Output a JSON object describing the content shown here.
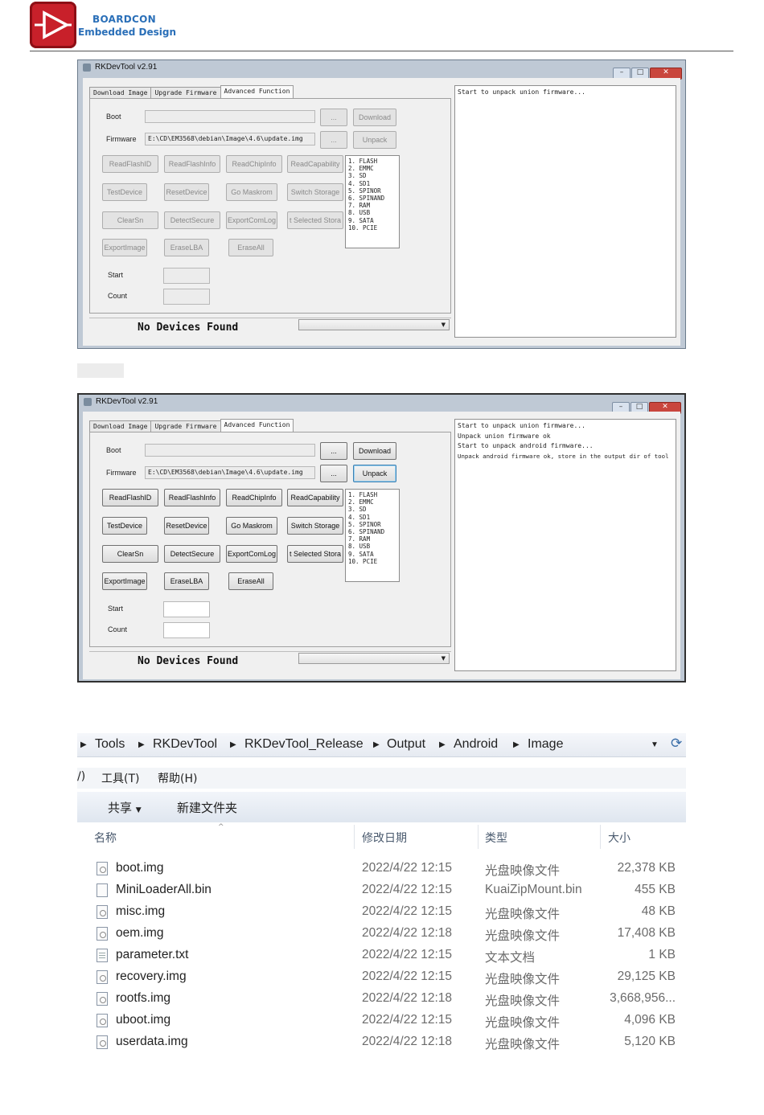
{
  "header": {
    "brand_line1": "BOARDCON",
    "brand_line2": "Embedded Design"
  },
  "tool": {
    "title": "RKDevTool v2.91",
    "tabs": [
      "Download Image",
      "Upgrade Firmware",
      "Advanced Function"
    ],
    "boot_label": "Boot",
    "firmware_label": "Firmware",
    "firmware_path": "E:\\CD\\EM3568\\debian\\Image\\4.6\\update.img",
    "browse_label": "...",
    "download_label": "Download",
    "unpack_label": "Unpack",
    "buttons": [
      "ReadFlashID",
      "ReadFlashInfo",
      "ReadChipInfo",
      "ReadCapability",
      "TestDevice",
      "ResetDevice",
      "Go Maskrom",
      "Switch Storage",
      "ClearSn",
      "DetectSecure",
      "ExportComLog",
      "t Selected Stora",
      "ExportImage",
      "EraseLBA",
      "EraseAll"
    ],
    "storage_list": [
      "1.  FLASH",
      "2.  EMMC",
      "3.  SD",
      "4.  SD1",
      "5.  SPINOR",
      "6.  SPINAND",
      "7.  RAM",
      "8.  USB",
      "9.  SATA",
      "10.  PCIE"
    ],
    "start_label": "Start",
    "count_label": "Count",
    "status": "No Devices Found",
    "log_first": [
      "Start  to  unpack  union  firmware..."
    ],
    "log_second": [
      "Start  to  unpack  union  firmware...",
      "Unpack  union  firmware  ok",
      "Start  to  unpack  android  firmware...",
      "Unpack  android  firmware  ok, store  in  the  output  dir  of  tool"
    ]
  },
  "explorer": {
    "breadcrumb": [
      "Tools",
      "RKDevTool",
      "RKDevTool_Release",
      "Output",
      "Android",
      "Image"
    ],
    "menu_fragment": "/)",
    "menu": [
      "工具(T)",
      "帮助(H)"
    ],
    "toolbar": {
      "share": "共享",
      "new_folder": "新建文件夹"
    },
    "columns": [
      "名称",
      "修改日期",
      "类型",
      "大小"
    ],
    "files": [
      {
        "name": "boot.img",
        "date": "2022/4/22 12:15",
        "type": "光盘映像文件",
        "size": "22,378 KB",
        "icon": "disc-image-icon"
      },
      {
        "name": "MiniLoaderAll.bin",
        "date": "2022/4/22 12:15",
        "type": "KuaiZipMount.bin",
        "size": "455 KB",
        "icon": "blank-file-icon"
      },
      {
        "name": "misc.img",
        "date": "2022/4/22 12:15",
        "type": "光盘映像文件",
        "size": "48 KB",
        "icon": "disc-image-icon"
      },
      {
        "name": "oem.img",
        "date": "2022/4/22 12:18",
        "type": "光盘映像文件",
        "size": "17,408 KB",
        "icon": "disc-image-icon"
      },
      {
        "name": "parameter.txt",
        "date": "2022/4/22 12:15",
        "type": "文本文档",
        "size": "1 KB",
        "icon": "text-file-icon"
      },
      {
        "name": "recovery.img",
        "date": "2022/4/22 12:15",
        "type": "光盘映像文件",
        "size": "29,125 KB",
        "icon": "disc-image-icon"
      },
      {
        "name": "rootfs.img",
        "date": "2022/4/22 12:18",
        "type": "光盘映像文件",
        "size": "3,668,956...",
        "icon": "disc-image-icon"
      },
      {
        "name": "uboot.img",
        "date": "2022/4/22 12:15",
        "type": "光盘映像文件",
        "size": "4,096 KB",
        "icon": "disc-image-icon"
      },
      {
        "name": "userdata.img",
        "date": "2022/4/22 12:18",
        "type": "光盘映像文件",
        "size": "5,120 KB",
        "icon": "disc-image-icon"
      }
    ]
  }
}
